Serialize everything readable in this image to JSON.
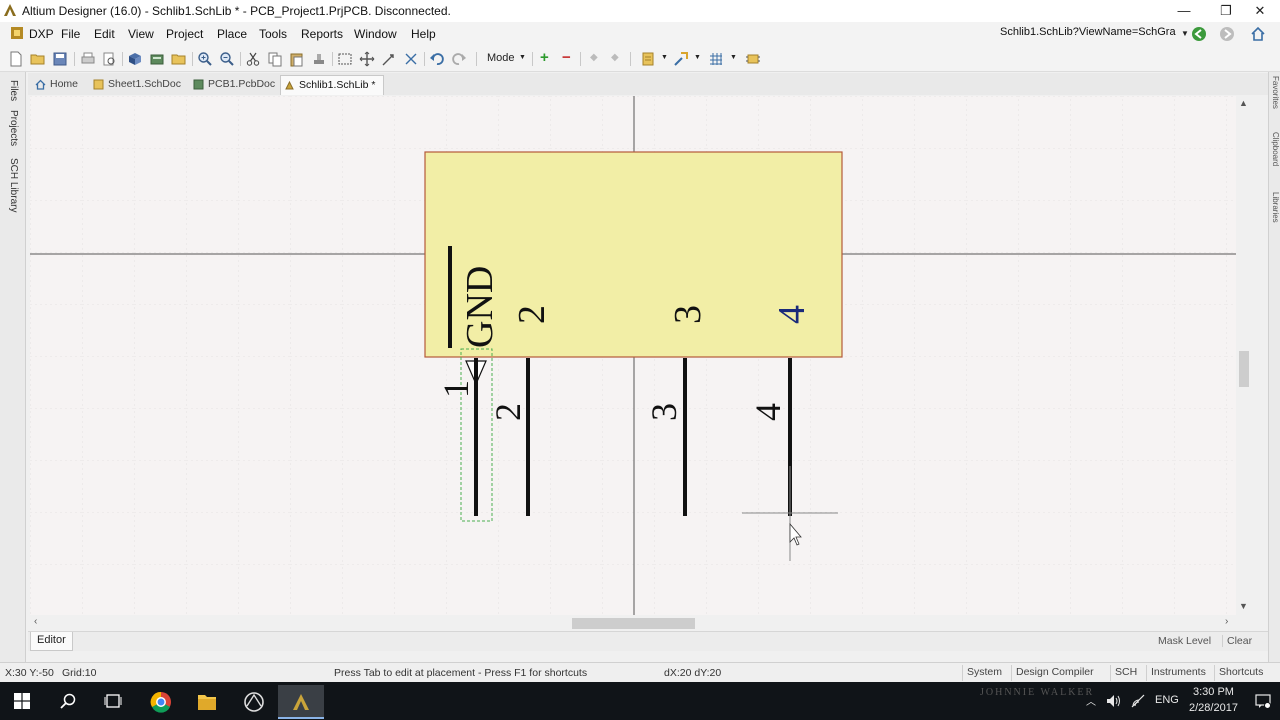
{
  "window": {
    "title": "Altium Designer (16.0) - Schlib1.SchLib * - PCB_Project1.PrjPCB. Disconnected.",
    "minimize_glyph": "—",
    "restore_glyph": "❐",
    "close_glyph": "✕"
  },
  "menu": {
    "items": [
      {
        "label": "DXP"
      },
      {
        "label": "File"
      },
      {
        "label": "Edit"
      },
      {
        "label": "View"
      },
      {
        "label": "Project"
      },
      {
        "label": "Place"
      },
      {
        "label": "Tools"
      },
      {
        "label": "Reports"
      },
      {
        "label": "Window"
      },
      {
        "label": "Help"
      }
    ],
    "address": "Schlib1.SchLib?ViewName=SchGra"
  },
  "toolbar": {
    "mode_label": "Mode",
    "icons": [
      "new-icon",
      "open-icon",
      "save-icon",
      "print-icon",
      "print-preview-icon",
      "3d-view-icon",
      "layers-icon",
      "folder-icon",
      "zoom-in-icon",
      "zoom-out-icon",
      "cut-icon",
      "copy-icon",
      "paste-icon",
      "rubber-stamp-icon",
      "select-area-icon",
      "move-icon",
      "drag-icon",
      "deselect-icon",
      "undo-icon",
      "redo-icon"
    ]
  },
  "tabs": [
    {
      "label": "Home"
    },
    {
      "label": "Sheet1.SchDoc"
    },
    {
      "label": "PCB1.PcbDoc"
    },
    {
      "label": "Schlib1.SchLib *"
    }
  ],
  "left_panel": {
    "labels": [
      "Files",
      "Projects",
      "SCH Library"
    ]
  },
  "right_panel": {
    "labels": [
      "Favorites",
      "Clipboard",
      "Libraries"
    ]
  },
  "component": {
    "body_color": "#f2eea6",
    "outline_color": "#b55a3a",
    "body_labels": [
      "GND",
      "2",
      "3",
      "4"
    ],
    "pin_designators": [
      "1",
      "2",
      "3",
      "4"
    ]
  },
  "editor": {
    "tab_label": "Editor",
    "mask_level": "Mask Level",
    "clear": "Clear"
  },
  "status": {
    "coords": "X:30 Y:-50",
    "grid": "Grid:10",
    "hint": "Press Tab to edit at placement - Press F1 for shortcuts",
    "delta": "dX:20 dY:20",
    "panels": [
      "System",
      "Design Compiler",
      "SCH",
      "Instruments",
      "Shortcuts"
    ]
  },
  "taskbar": {
    "time": "3:30 PM",
    "date": "2/28/2017",
    "lang": "ENG",
    "wallpaper_text": "JOHNNIE WALKER"
  }
}
